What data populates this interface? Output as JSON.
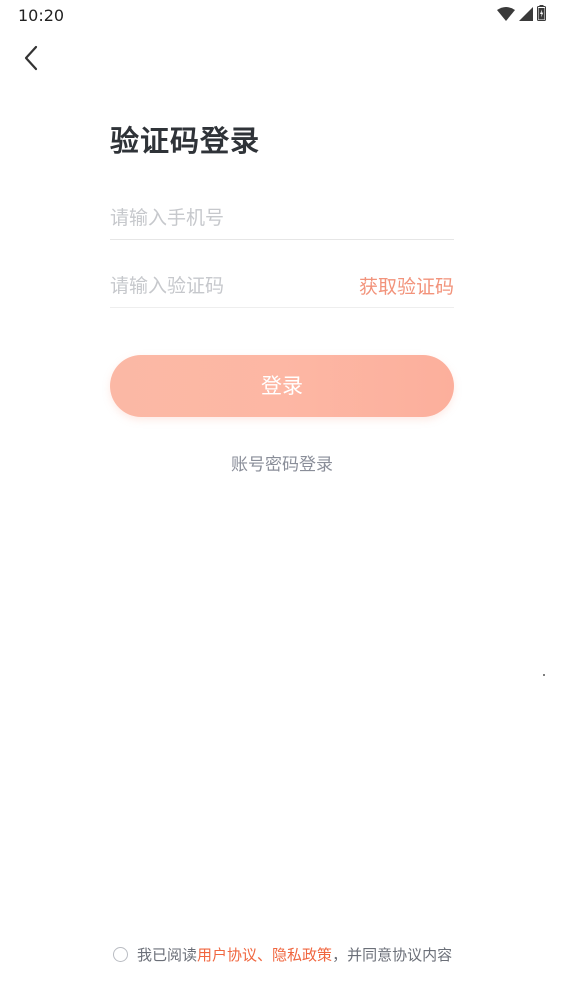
{
  "status_bar": {
    "time": "10:20",
    "icons": [
      "wifi-icon",
      "signal-icon",
      "battery-icon"
    ]
  },
  "nav": {
    "back_icon": "chevron-left-icon"
  },
  "title": "验证码登录",
  "phone_input": {
    "placeholder": "请输入手机号",
    "value": ""
  },
  "code_input": {
    "placeholder": "请输入验证码",
    "value": ""
  },
  "get_code_label": "获取验证码",
  "login_label": "登录",
  "password_login_label": "账号密码登录",
  "agreement": {
    "checked": false,
    "prefix": "我已阅读",
    "user_agreement": "用户协议",
    "separator": "、",
    "privacy_policy": "隐私政策",
    "suffix": "，并同意协议内容"
  },
  "colors": {
    "accent": "#f2937b",
    "button_gradient_start": "#fbb8a5",
    "button_gradient_end": "#fcaf9c",
    "link": "#f0663f",
    "title": "#2f3338"
  }
}
